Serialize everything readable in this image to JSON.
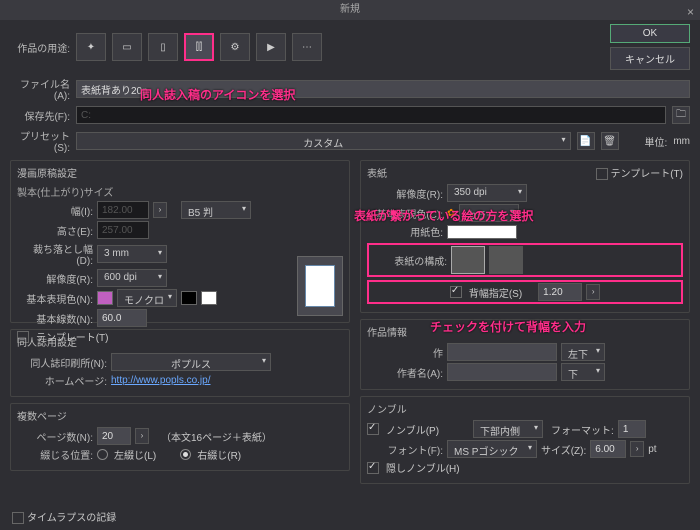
{
  "window": {
    "title": "新規"
  },
  "labels": {
    "purpose": "作品の用途:",
    "filename": "ファイル名(A):",
    "saveto": "保存先(F):",
    "preset": "プリセット(S):",
    "unit": "単位:",
    "unit_val": "mm"
  },
  "buttons": {
    "ok": "OK",
    "cancel": "キャンセル"
  },
  "file": {
    "name": "表紙背あり20p",
    "path": "C:"
  },
  "preset": {
    "value": "カスタム"
  },
  "manga": {
    "title": "漫画原稿設定",
    "sub1": "製本(仕上がり)サイズ",
    "width_l": "幅(I):",
    "width_v": "182.00",
    "size_dd": "B5 判",
    "height_l": "高さ(E):",
    "height_v": "257.00",
    "bleed_l": "裁ち落とし幅(D):",
    "bleed_v": "3 mm",
    "dpi_l": "解像度(R):",
    "dpi_v": "600 dpi",
    "color_l": "基本表現色(N):",
    "color_v": "モノクロ",
    "lines_l": "基本線数(N):",
    "lines_v": "60.0",
    "template": "テンプレート(T)"
  },
  "doujin": {
    "title": "同人誌用設定",
    "printer_l": "同人誌印刷所(N):",
    "printer_v": "ポプルス",
    "hp_l": "ホームページ:",
    "hp_url": "http://www.popls.co.jp/"
  },
  "multi": {
    "title": "複数ページ",
    "pages_l": "ページ数(N):",
    "pages_v": "20",
    "pages_note": "（本文16ページ＋表紙）",
    "bind_l": "綴じる位置:",
    "left": "左綴じ(L)",
    "right": "右綴じ(R)"
  },
  "cover": {
    "title": "表紙",
    "dpi_l": "解像度(R):",
    "dpi_v": "350 dpi",
    "color_l": "基本表現色(C):",
    "color_v": "カラー",
    "paper_l": "用紙色:",
    "compose_l": "表紙の構成:",
    "spine_chk": "背幅指定(S)",
    "spine_v": "1.20",
    "template": "テンプレート(T)"
  },
  "info": {
    "title": "作品情報",
    "work_l": "作",
    "work_dd": "左下",
    "author_l": "作者名(A):",
    "author_dd": "下"
  },
  "nombre": {
    "title": "ノンブル",
    "enable": "ノンブル(P)",
    "pos_v": "下部内側",
    "fmt_l": "フォーマット:",
    "fmt_v": "1",
    "font_l": "フォント(F):",
    "font_v": "MS Pゴシック",
    "size_l": "サイズ(Z):",
    "size_v": "6.00",
    "pt": "pt",
    "hidden": "隠しノンブル(H)"
  },
  "timelapse": "タイムラプスの記録",
  "anno": {
    "a1": "同人誌入稿のアイコンを選択",
    "a2": "表紙が繋がっている絵の方を選択",
    "a3": "チェックを付けて背幅を入力"
  }
}
